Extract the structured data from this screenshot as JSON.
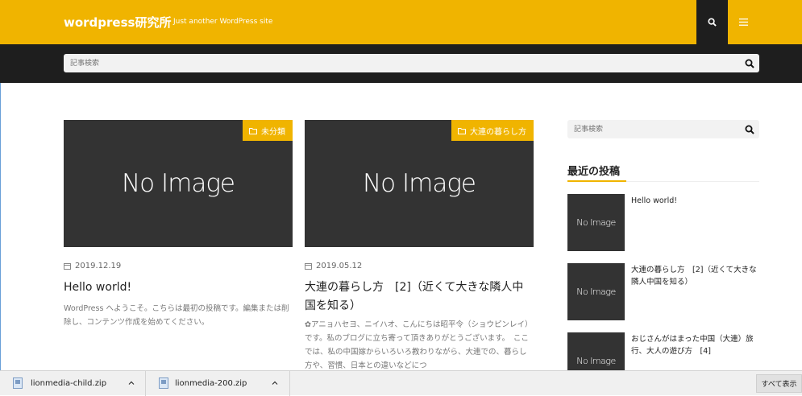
{
  "header": {
    "site_title": "wordpress研究所",
    "tagline": "Just another WordPress site",
    "search_icon": "search-icon",
    "menu_icon": "hamburger-menu-icon"
  },
  "searchbar": {
    "placeholder": "記事検索"
  },
  "posts": [
    {
      "category": "未分類",
      "thumb_text": "No Image",
      "date": "2019.12.19",
      "title": "Hello world!",
      "excerpt": "WordPress へようこそ。こちらは最初の投稿です。編集または削除し、コンテンツ作成を始めてください。"
    },
    {
      "category": "大連の暮らし方",
      "thumb_text": "No Image",
      "date": "2019.05.12",
      "title": "大連の暮らし方　[2]（近くて大きな隣人中国を知る）",
      "excerpt": "✿アニョハセヨ、ニイハオ、こんにちは昭平令（ショウピンレイ）　です。私のブログに立ち寄って頂きありがとうございます。　ここでは、私の中国嫁からいろいろ教わりながら、大連での、暮らし方や、習慣、日本との違いなどにつ"
    }
  ],
  "sidebar": {
    "search_placeholder": "記事検索",
    "recent_heading": "最近の投稿",
    "recent": [
      {
        "thumb_text": "No Image",
        "title": "Hello world!"
      },
      {
        "thumb_text": "No Image",
        "title": "大連の暮らし方　[2]（近くて大きな隣人中国を知る）"
      },
      {
        "thumb_text": "No Image",
        "title": "おじさんがはまった中国（大連）旅行、大人の遊び方　[4]"
      }
    ]
  },
  "downloads": {
    "items": [
      {
        "name": "lionmedia-child.zip"
      },
      {
        "name": "lionmedia-200.zip"
      }
    ],
    "show_all": "すべて表示"
  },
  "colors": {
    "accent": "#f0b400",
    "dark": "#1e1e1e",
    "thumb": "#333333"
  }
}
